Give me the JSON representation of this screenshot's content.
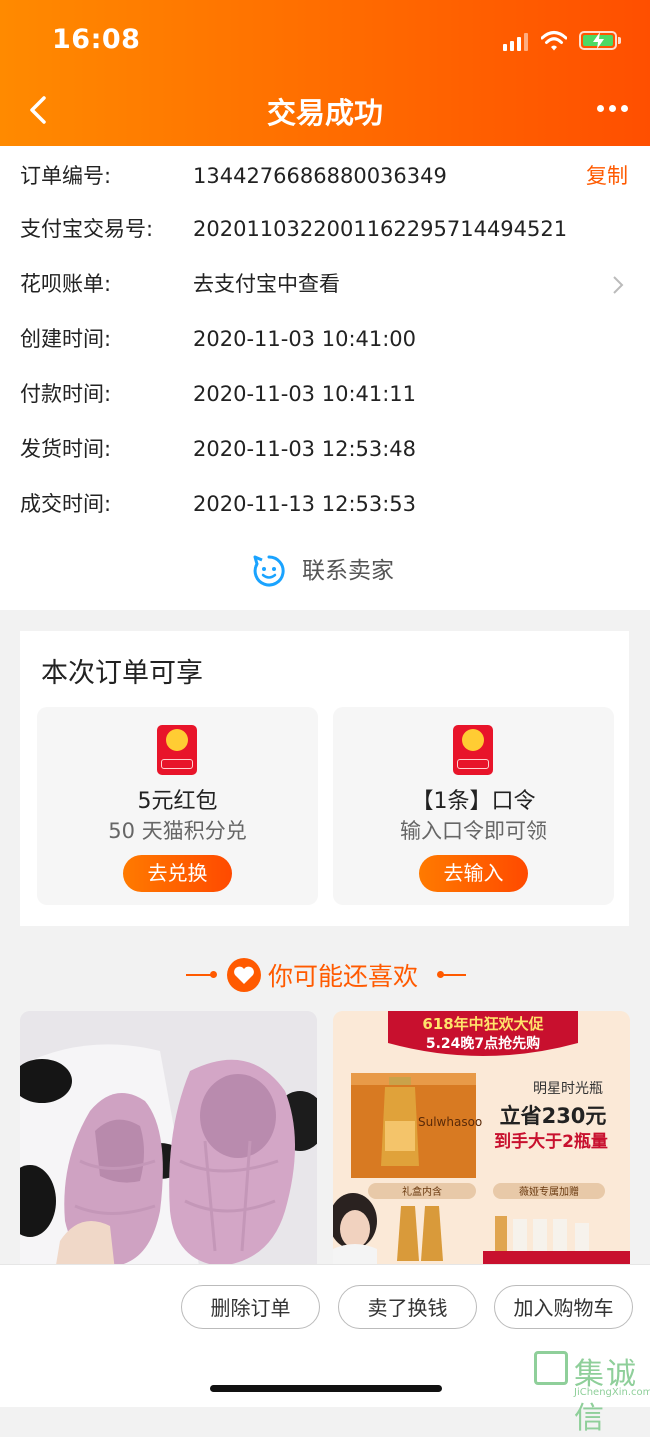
{
  "status_bar": {
    "time": "16:08"
  },
  "nav": {
    "title": "交易成功"
  },
  "order_info": {
    "copy_label": "复制",
    "rows": [
      {
        "label": "订单编号:",
        "value": "1344276686880036349"
      },
      {
        "label": "支付宝交易号:",
        "value": "2020110322001162295714494521"
      },
      {
        "label": "花呗账单:",
        "value": "去支付宝中查看"
      },
      {
        "label": "创建时间:",
        "value": "2020-11-03 10:41:00"
      },
      {
        "label": "付款时间:",
        "value": "2020-11-03 10:41:11"
      },
      {
        "label": "发货时间:",
        "value": "2020-11-03 12:53:48"
      },
      {
        "label": "成交时间:",
        "value": "2020-11-13 12:53:53"
      }
    ]
  },
  "contact": {
    "label": "联系卖家"
  },
  "benefits": {
    "title": "本次订单可享",
    "items": [
      {
        "name": "5元红包",
        "desc": "50 天猫积分兑",
        "button": "去兑换"
      },
      {
        "name": "【1条】口令",
        "desc": "输入口令即可领",
        "button": "去输入"
      }
    ]
  },
  "recommend": {
    "title": "你可能还喜欢",
    "promo": {
      "banner_line1": "618年中狂欢大促",
      "banner_line2": "5.24晚7点抢先购",
      "tag": "明星时光瓶",
      "save": "立省230元",
      "deal": "到手大于2瓶量",
      "brand": "Sulwhasoo",
      "gift_left": "礼盒内含",
      "gift_right": "薇娅专属加赠"
    }
  },
  "actions": {
    "delete": "删除订单",
    "resell": "卖了换钱",
    "add_cart": "加入购物车"
  },
  "watermark": {
    "text": "集诚信",
    "sub": "JiChengXin.com"
  },
  "colors": {
    "accent": "#ff5a00",
    "header_start": "#ff8a00",
    "header_end": "#ff4f00"
  }
}
